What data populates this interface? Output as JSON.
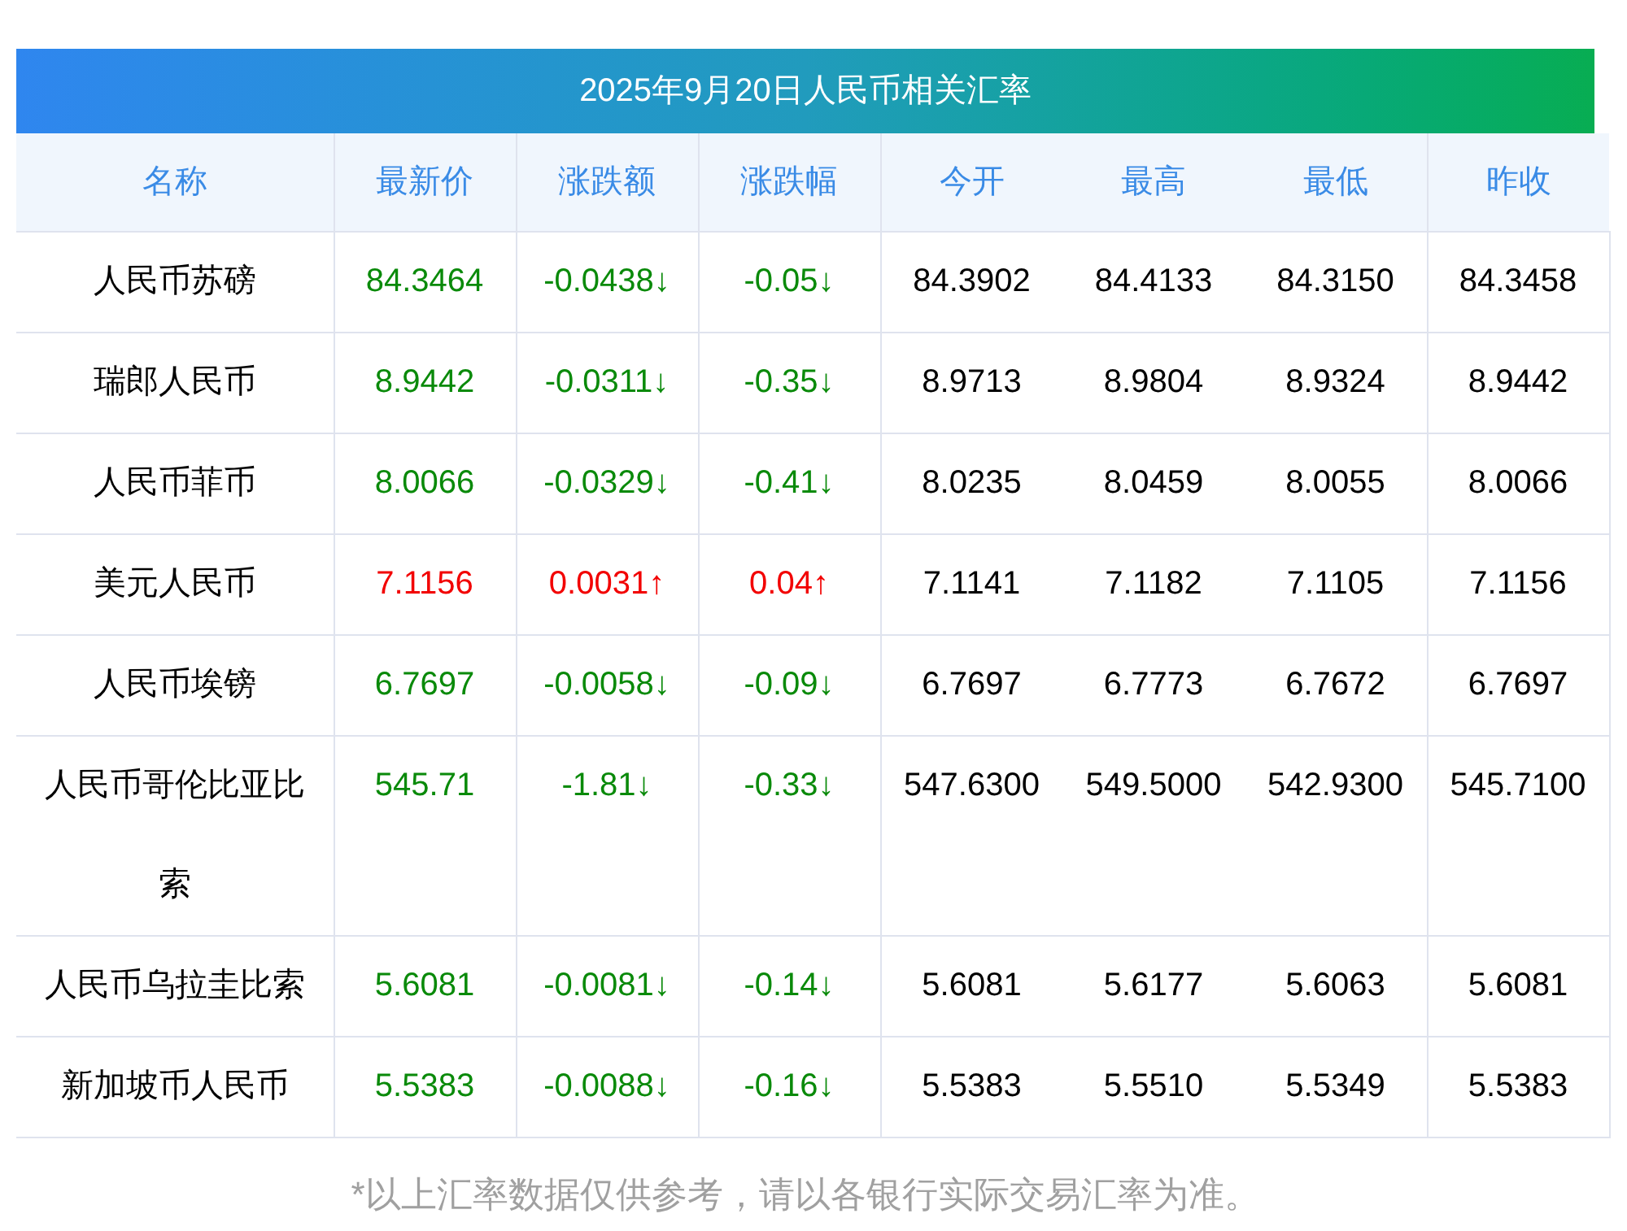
{
  "title": "2025年9月20日人民币相关汇率",
  "columns": [
    "名称",
    "最新价",
    "涨跌额",
    "涨跌幅",
    "今开",
    "最高",
    "最低",
    "昨收"
  ],
  "rows": [
    {
      "name": "人民币苏磅",
      "rising": false,
      "latest": "84.3464",
      "change": "-0.0438↓",
      "percent": "-0.05↓",
      "open": "84.3902",
      "high": "84.4133",
      "low": "84.3150",
      "prev_close": "84.3458"
    },
    {
      "name": "瑞郎人民币",
      "rising": false,
      "latest": "8.9442",
      "change": "-0.0311↓",
      "percent": "-0.35↓",
      "open": "8.9713",
      "high": "8.9804",
      "low": "8.9324",
      "prev_close": "8.9442"
    },
    {
      "name": "人民币菲币",
      "rising": false,
      "latest": "8.0066",
      "change": "-0.0329↓",
      "percent": "-0.41↓",
      "open": "8.0235",
      "high": "8.0459",
      "low": "8.0055",
      "prev_close": "8.0066"
    },
    {
      "name": "美元人民币",
      "rising": true,
      "latest": "7.1156",
      "change": "0.0031↑",
      "percent": "0.04↑",
      "open": "7.1141",
      "high": "7.1182",
      "low": "7.1105",
      "prev_close": "7.1156"
    },
    {
      "name": "人民币埃镑",
      "rising": false,
      "latest": "6.7697",
      "change": "-0.0058↓",
      "percent": "-0.09↓",
      "open": "6.7697",
      "high": "6.7773",
      "low": "6.7672",
      "prev_close": "6.7697"
    },
    {
      "name": "人民币哥伦比亚比索",
      "rising": false,
      "latest": "545.71",
      "change": "-1.81↓",
      "percent": "-0.33↓",
      "open": "547.6300",
      "high": "549.5000",
      "low": "542.9300",
      "prev_close": "545.7100"
    },
    {
      "name": "人民币乌拉圭比索",
      "rising": false,
      "latest": "5.6081",
      "change": "-0.0081↓",
      "percent": "-0.14↓",
      "open": "5.6081",
      "high": "5.6177",
      "low": "5.6063",
      "prev_close": "5.6081"
    },
    {
      "name": "新加坡币人民币",
      "rising": false,
      "latest": "5.5383",
      "change": "-0.0088↓",
      "percent": "-0.16↓",
      "open": "5.5383",
      "high": "5.5510",
      "low": "5.5349",
      "prev_close": "5.5383"
    }
  ],
  "footnote": "*以上汇率数据仅供参考，请以各银行实际交易汇率为准。"
}
